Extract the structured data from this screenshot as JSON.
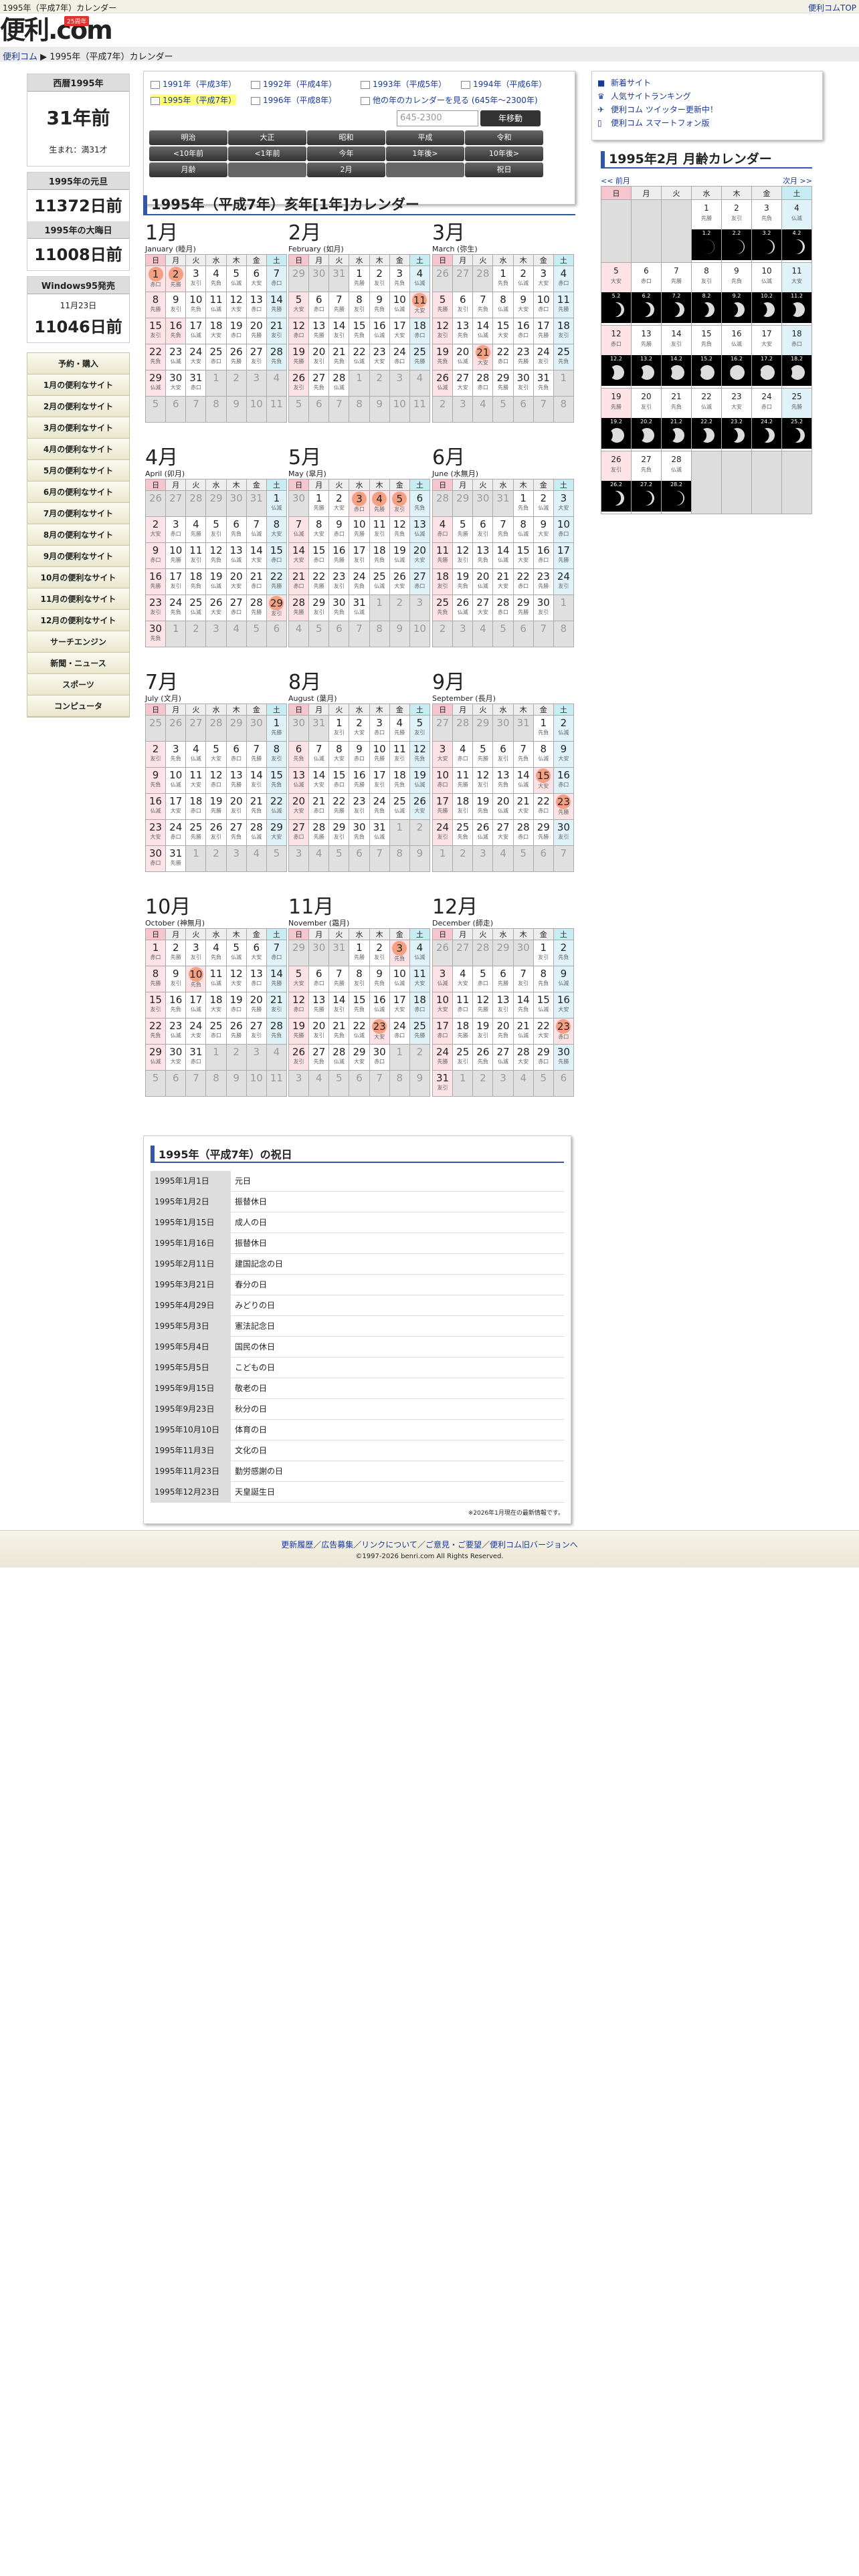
{
  "page": {
    "title": "1995年（平成7年）カレンダー",
    "top_link": "便利コムTOP"
  },
  "logo": {
    "text": "便利.com",
    "badge": "25周年"
  },
  "breadcrumb": {
    "home": "便利コム",
    "sep": "▶",
    "current": "1995年（平成7年）カレンダー"
  },
  "left": {
    "year_box": {
      "header": "西暦1995年",
      "years_ago": "31年前",
      "born": "生まれ：満31才"
    },
    "newyear_box": {
      "header": "1995年の元旦",
      "days": "11372日前"
    },
    "newyearseve_box": {
      "header": "1995年の大晦日",
      "days": "11008日前"
    },
    "win95_box": {
      "header": "Windows95発売",
      "date": "11月23日",
      "days": "11046日前"
    },
    "nav": [
      "予約・購入",
      "1月の便利なサイト",
      "2月の便利なサイト",
      "3月の便利なサイト",
      "4月の便利なサイト",
      "5月の便利なサイト",
      "6月の便利なサイト",
      "7月の便利なサイト",
      "8月の便利なサイト",
      "9月の便利なサイト",
      "10月の便利なサイト",
      "11月の便利なサイト",
      "12月の便利なサイト",
      "サーチエンジン",
      "新聞・ニュース",
      "スポーツ",
      "コンピュータ"
    ]
  },
  "selector": {
    "years": [
      "1991年（平成3年）",
      "1992年（平成4年）",
      "1993年（平成5年）",
      "1994年（平成6年）",
      "1995年（平成7年）",
      "1996年（平成8年）",
      "他の年のカレンダーを見る (645年〜2300年)"
    ],
    "input_placeholder": "645-2300",
    "go_button": "年移動",
    "eras": [
      "明治",
      "大正",
      "昭和",
      "平成",
      "令和"
    ],
    "nav": [
      "<10年前",
      "<1年前",
      "今年",
      "1年後>",
      "10年後>"
    ],
    "row3": [
      "月齢",
      "",
      "2月",
      "",
      "祝日"
    ]
  },
  "calendar": {
    "title": "1995年（平成7年）亥年[1年]カレンダー",
    "weekdays": [
      "日",
      "月",
      "火",
      "水",
      "木",
      "金",
      "土"
    ],
    "months": [
      {
        "name": "1月",
        "sub": "January (睦月)",
        "start": 0,
        "days": 31,
        "pstart": 25,
        "circles": [
          1,
          2
        ],
        "holidays": [
          1,
          2,
          15,
          16
        ],
        "rk": [
          "赤口",
          "先勝",
          "友引",
          "先負",
          "仏滅",
          "大安",
          "赤口",
          "先勝",
          "友引",
          "先負",
          "仏滅",
          "大安",
          "赤口",
          "先勝",
          "友引",
          "先負",
          "仏滅",
          "大安",
          "赤口",
          "先勝",
          "友引",
          "先負",
          "仏滅",
          "大安",
          "赤口",
          "先勝",
          "友引",
          "先負",
          "仏滅",
          "大安",
          "赤口"
        ]
      },
      {
        "name": "2月",
        "sub": "February (如月)",
        "start": 3,
        "days": 28,
        "pstart": 29,
        "circles": [
          11
        ],
        "holidays": [
          11
        ],
        "rk": [
          "先勝",
          "友引",
          "先負",
          "仏滅",
          "大安",
          "赤口",
          "先勝",
          "友引",
          "先負",
          "仏滅",
          "大安",
          "赤口",
          "先勝",
          "友引",
          "先負",
          "仏滅",
          "大安",
          "赤口",
          "先勝",
          "友引",
          "先負",
          "仏滅",
          "大安",
          "赤口",
          "先勝",
          "友引",
          "先負",
          "仏滅"
        ]
      },
      {
        "name": "3月",
        "sub": "March (弥生)",
        "start": 3,
        "days": 31,
        "pstart": 26,
        "circles": [
          21
        ],
        "holidays": [
          21
        ],
        "rk": [
          "先負",
          "仏滅",
          "大安",
          "赤口",
          "先勝",
          "友引",
          "先負",
          "仏滅",
          "大安",
          "赤口",
          "先勝",
          "友引",
          "先負",
          "仏滅",
          "大安",
          "赤口",
          "先勝",
          "友引",
          "先負",
          "仏滅",
          "大安",
          "赤口",
          "先勝",
          "友引",
          "先負",
          "仏滅",
          "大安",
          "赤口",
          "先勝",
          "友引",
          "先負"
        ]
      },
      {
        "name": "4月",
        "sub": "April (卯月)",
        "start": 6,
        "days": 30,
        "pstart": 26,
        "circles": [
          29
        ],
        "holidays": [
          29
        ],
        "rk": [
          "仏滅",
          "大安",
          "赤口",
          "先勝",
          "友引",
          "先負",
          "仏滅",
          "大安",
          "赤口",
          "先勝",
          "友引",
          "先負",
          "仏滅",
          "大安",
          "赤口",
          "先勝",
          "友引",
          "先負",
          "仏滅",
          "大安",
          "赤口",
          "先勝",
          "友引",
          "先負",
          "仏滅",
          "大安",
          "赤口",
          "先勝",
          "友引",
          "先負"
        ]
      },
      {
        "name": "5月",
        "sub": "May (皐月)",
        "start": 1,
        "days": 31,
        "pstart": 30,
        "circles": [
          3,
          4,
          5
        ],
        "holidays": [
          3,
          4,
          5
        ],
        "rk": [
          "先勝",
          "大安",
          "赤口",
          "先勝",
          "友引",
          "先負",
          "仏滅",
          "大安",
          "赤口",
          "先勝",
          "友引",
          "先負",
          "仏滅",
          "大安",
          "赤口",
          "先勝",
          "友引",
          "先負",
          "仏滅",
          "大安",
          "赤口",
          "先勝",
          "友引",
          "先負",
          "仏滅",
          "大安",
          "赤口",
          "先勝",
          "友引",
          "先負",
          "仏滅"
        ]
      },
      {
        "name": "6月",
        "sub": "June (水無月)",
        "start": 4,
        "days": 30,
        "pstart": 28,
        "circles": [],
        "holidays": [],
        "rk": [
          "先負",
          "仏滅",
          "大安",
          "赤口",
          "先勝",
          "友引",
          "先負",
          "仏滅",
          "大安",
          "赤口",
          "先勝",
          "友引",
          "先負",
          "仏滅",
          "大安",
          "赤口",
          "先勝",
          "友引",
          "先負",
          "仏滅",
          "大安",
          "赤口",
          "先勝",
          "友引",
          "先負",
          "仏滅",
          "大安",
          "赤口",
          "先勝",
          "友引"
        ]
      },
      {
        "name": "7月",
        "sub": "July (文月)",
        "start": 6,
        "days": 31,
        "pstart": 25,
        "circles": [],
        "holidays": [],
        "rk": [
          "先勝",
          "友引",
          "先負",
          "仏滅",
          "大安",
          "赤口",
          "先勝",
          "友引",
          "先負",
          "仏滅",
          "大安",
          "赤口",
          "先勝",
          "友引",
          "先負",
          "仏滅",
          "大安",
          "赤口",
          "先勝",
          "友引",
          "先負",
          "仏滅",
          "大安",
          "赤口",
          "先勝",
          "友引",
          "先負",
          "仏滅",
          "大安",
          "赤口",
          "先勝"
        ]
      },
      {
        "name": "8月",
        "sub": "August (葉月)",
        "start": 2,
        "days": 31,
        "pstart": 30,
        "circles": [],
        "holidays": [],
        "rk": [
          "友引",
          "大安",
          "赤口",
          "先勝",
          "友引",
          "先負",
          "仏滅",
          "大安",
          "赤口",
          "先勝",
          "友引",
          "先負",
          "仏滅",
          "大安",
          "赤口",
          "先勝",
          "友引",
          "先負",
          "仏滅",
          "大安",
          "赤口",
          "先勝",
          "友引",
          "先負",
          "仏滅",
          "大安",
          "赤口",
          "先勝",
          "友引",
          "先負",
          "仏滅"
        ]
      },
      {
        "name": "9月",
        "sub": "September (長月)",
        "start": 5,
        "days": 30,
        "pstart": 27,
        "circles": [
          15,
          23
        ],
        "holidays": [
          15,
          23
        ],
        "rk": [
          "先負",
          "仏滅",
          "大安",
          "赤口",
          "先勝",
          "友引",
          "先負",
          "仏滅",
          "大安",
          "赤口",
          "先勝",
          "友引",
          "先負",
          "仏滅",
          "大安",
          "赤口",
          "先勝",
          "友引",
          "先負",
          "仏滅",
          "大安",
          "赤口",
          "先勝",
          "友引",
          "先負",
          "仏滅",
          "大安",
          "赤口",
          "先勝",
          "友引"
        ]
      },
      {
        "name": "10月",
        "sub": "October (神無月)",
        "start": 0,
        "days": 31,
        "pstart": 0,
        "circles": [
          10
        ],
        "holidays": [
          10
        ],
        "rk": [
          "赤口",
          "先勝",
          "友引",
          "先負",
          "仏滅",
          "大安",
          "赤口",
          "先勝",
          "友引",
          "先負",
          "仏滅",
          "大安",
          "赤口",
          "先勝",
          "友引",
          "先負",
          "仏滅",
          "大安",
          "赤口",
          "先勝",
          "友引",
          "先負",
          "仏滅",
          "大安",
          "赤口",
          "先勝",
          "友引",
          "先負",
          "仏滅",
          "大安",
          "赤口"
        ]
      },
      {
        "name": "11月",
        "sub": "November (霜月)",
        "start": 3,
        "days": 30,
        "pstart": 29,
        "circles": [
          3,
          23
        ],
        "holidays": [
          3,
          23
        ],
        "rk": [
          "先勝",
          "友引",
          "先負",
          "仏滅",
          "大安",
          "赤口",
          "先勝",
          "友引",
          "先負",
          "仏滅",
          "大安",
          "赤口",
          "先勝",
          "友引",
          "先負",
          "仏滅",
          "大安",
          "赤口",
          "先勝",
          "友引",
          "先負",
          "仏滅",
          "大安",
          "赤口",
          "先勝",
          "友引",
          "先負",
          "仏滅",
          "大安",
          "赤口"
        ]
      },
      {
        "name": "12月",
        "sub": "December (師走)",
        "start": 5,
        "days": 31,
        "pstart": 26,
        "circles": [
          23
        ],
        "holidays": [
          23
        ],
        "rk": [
          "友引",
          "先負",
          "仏滅",
          "大安",
          "赤口",
          "先勝",
          "友引",
          "先負",
          "仏滅",
          "大安",
          "赤口",
          "先勝",
          "友引",
          "先負",
          "仏滅",
          "大安",
          "赤口",
          "先勝",
          "友引",
          "先負",
          "仏滅",
          "大安",
          "赤口",
          "先勝",
          "友引",
          "先負",
          "仏滅",
          "大安",
          "赤口",
          "先勝",
          "友引"
        ]
      }
    ]
  },
  "holidays": {
    "title": "1995年（平成7年）の祝日",
    "list": [
      [
        "1995年1月1日",
        "元日"
      ],
      [
        "1995年1月2日",
        "振替休日"
      ],
      [
        "1995年1月15日",
        "成人の日"
      ],
      [
        "1995年1月16日",
        "振替休日"
      ],
      [
        "1995年2月11日",
        "建国記念の日"
      ],
      [
        "1995年3月21日",
        "春分の日"
      ],
      [
        "1995年4月29日",
        "みどりの日"
      ],
      [
        "1995年5月3日",
        "憲法記念日"
      ],
      [
        "1995年5月4日",
        "国民の休日"
      ],
      [
        "1995年5月5日",
        "こどもの日"
      ],
      [
        "1995年9月15日",
        "敬老の日"
      ],
      [
        "1995年9月23日",
        "秋分の日"
      ],
      [
        "1995年10月10日",
        "体育の日"
      ],
      [
        "1995年11月3日",
        "文化の日"
      ],
      [
        "1995年11月23日",
        "勤労感謝の日"
      ],
      [
        "1995年12月23日",
        "天皇誕生日"
      ]
    ],
    "note": "※2026年1月現在の最新情報です。"
  },
  "right": {
    "links": [
      "新着サイト",
      "人気サイトランキング",
      "便利コム ツイッター更新中！",
      "便利コム スマートフォン版"
    ],
    "icons": [
      "new-icon",
      "ranking-icon",
      "twitter-icon",
      "smartphone-icon"
    ]
  },
  "moon": {
    "title": "1995年2月 月齢カレンダー",
    "prev": "<< 前月",
    "next": "次月 >>",
    "start": 3,
    "days": 28,
    "rk": [
      "先勝",
      "友引",
      "先負",
      "仏滅",
      "大安",
      "赤口",
      "先勝",
      "友引",
      "先負",
      "仏滅",
      "大安",
      "赤口",
      "先勝",
      "友引",
      "先負",
      "仏滅",
      "大安",
      "赤口",
      "先勝",
      "友引",
      "先負",
      "仏滅",
      "大安",
      "赤口",
      "先勝",
      "友引",
      "先負",
      "仏滅"
    ],
    "dates": [
      "1.2",
      "2.2",
      "3.2",
      "4.2",
      "5.2",
      "6.2",
      "7.2",
      "8.2",
      "9.2",
      "10.2",
      "11.2",
      "12.2",
      "13.2",
      "14.2",
      "15.2",
      "16.2",
      "17.2",
      "18.2",
      "19.2",
      "20.2",
      "21.2",
      "22.2",
      "23.2",
      "24.2",
      "25.2",
      "26.2",
      "27.2",
      "28.2"
    ],
    "phase": [
      0.02,
      0.06,
      0.1,
      0.14,
      0.2,
      0.26,
      0.32,
      0.38,
      0.45,
      0.52,
      0.6,
      0.68,
      0.76,
      0.84,
      0.92,
      0.98,
      0.94,
      0.86,
      0.78,
      0.7,
      0.62,
      0.54,
      0.46,
      0.38,
      0.3,
      0.22,
      0.14,
      0.08
    ]
  },
  "footer": {
    "links": [
      "更新履歴",
      "広告募集",
      "リンクについて",
      "ご意見・ご要望",
      "便利コム旧バージョンへ"
    ],
    "sep": "／",
    "copyright": "©1997-2026 benri.com All Rights Reserved."
  },
  "colors": {
    "accent": "#3355aa",
    "link": "#1a3a9a",
    "holiday": "#f5a080",
    "sunday": "#fde2e6",
    "saturday": "#dff2f8"
  }
}
